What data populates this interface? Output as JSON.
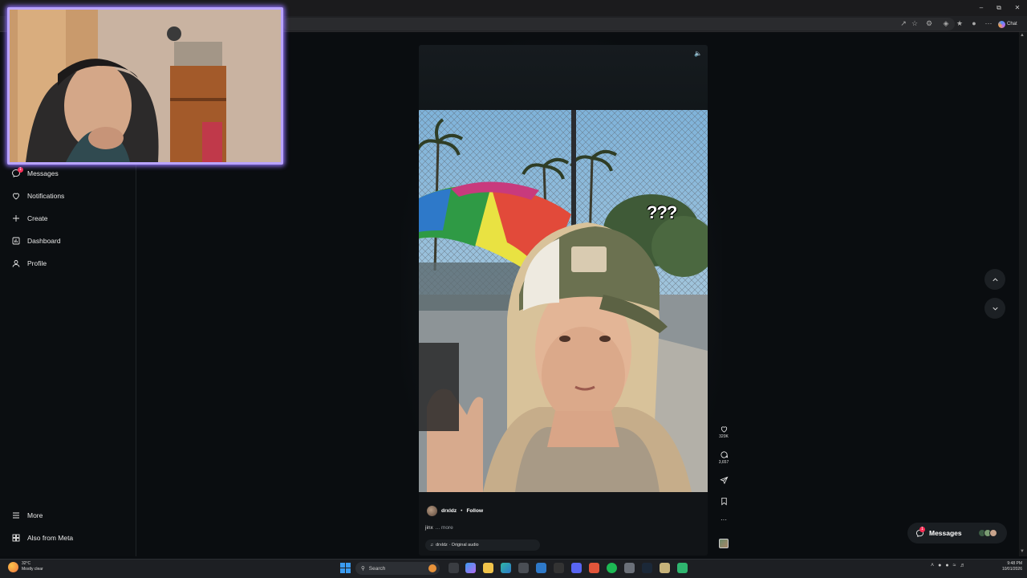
{
  "browser": {
    "chat_label": "Chat",
    "toolbar_icons": [
      "share-icon",
      "star-icon",
      "extension-icon",
      "extensions-puzzle-icon",
      "favorites-icon",
      "collections-icon",
      "profile-icon",
      "menu-dots-icon"
    ]
  },
  "sidebar": {
    "items": [
      {
        "label": "Messages",
        "icon": "messenger-icon",
        "badge": "1"
      },
      {
        "label": "Notifications",
        "icon": "heart-icon"
      },
      {
        "label": "Create",
        "icon": "plus-icon"
      },
      {
        "label": "Dashboard",
        "icon": "chart-icon"
      },
      {
        "label": "Profile",
        "icon": "profile-avatar-icon"
      }
    ],
    "bottom_items": [
      {
        "label": "More",
        "icon": "hamburger-icon"
      },
      {
        "label": "Also from Meta",
        "icon": "meta-icon"
      }
    ]
  },
  "reel": {
    "overlay_text": "???",
    "author": "drxldz",
    "separator": "•",
    "follow_label": "Follow",
    "caption": "jinx",
    "more_label": "... more",
    "audio": "drxldz · Original audio",
    "likes": "320K",
    "comments": "3,657",
    "more_actions": "···"
  },
  "messages_pill": {
    "label": "Messages",
    "badge": "1"
  },
  "taskbar": {
    "weather_temp": "32°C",
    "weather_desc": "Mostly clear",
    "search_placeholder": "Search",
    "time": "9:48 PM",
    "date": "10/01/2026"
  },
  "colors": {
    "accent_badge": "#ff2d55",
    "webcam_border": "#b9a4ff"
  }
}
